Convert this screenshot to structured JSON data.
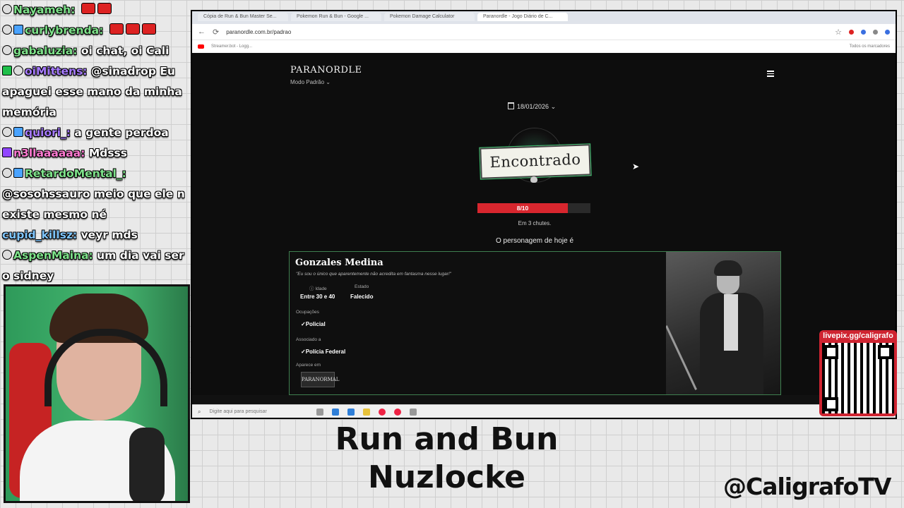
{
  "chat": [
    {
      "user": "Nayameh:",
      "text": "",
      "color": "green",
      "emotes": 2
    },
    {
      "user": "curlybrenda:",
      "text": "",
      "color": "green",
      "emotes": 3
    },
    {
      "user": "gabaluzia:",
      "text": "oi chat, oi Cali",
      "color": "green",
      "emotes": 0
    },
    {
      "user": "oiMittens:",
      "text": "@sinadrop Eu apaguei esse mano da minha memória",
      "color": "purple",
      "emotes": 0
    },
    {
      "user": "quiori_:",
      "text": "a gente perdoa",
      "color": "purple",
      "emotes": 0
    },
    {
      "user": "n3llaaaaaa:",
      "text": "Mdsss",
      "color": "pink",
      "emotes": 0
    },
    {
      "user": "RetardoMental_:",
      "text": "@sosohssauro meio que ele n existe mesmo né",
      "color": "green",
      "emotes": 0
    },
    {
      "user": "cupid_killsz:",
      "text": "veyr mds",
      "color": "green",
      "emotes": 0
    },
    {
      "user": "AspenMaina:",
      "text": "um dia vai ser o sidney",
      "color": "green",
      "emotes": 0
    }
  ],
  "browser": {
    "tabs": [
      "Cópia de Run & Bun Master Se...",
      "Pokemon Run & Bun - Google ...",
      "Pokemon Damage Calculator",
      "Paranordle - Jogo Diário de C..."
    ],
    "active_tab": 3,
    "url": "paranordle.com.br/padrao",
    "bookmark": "Streamer.bot - Logg...",
    "bookmarks_folder": "Todos os marcadores"
  },
  "site": {
    "logo": "PARANORDLE",
    "mode": "Modo Padrão",
    "date": "18/01/2026",
    "stamp": "Encontrado",
    "score_label": "8/10",
    "score_fraction": 0.8,
    "guesses": "Em 3 chutes.",
    "today_label": "O personagem de hoje é",
    "character": {
      "name": "Gonzales Medina",
      "quote": "\"Eu sou o único que aparentemente não acredita em fantasma nesse lugar!\"",
      "age_label": "Idade",
      "age_value": "Entre 30 e 40",
      "state_label": "Estado",
      "state_value": "Falecido",
      "occupations_label": "Ocupações",
      "occupation": "Policial",
      "associated_label": "Associado a",
      "associated": "Polícia Federal",
      "appears_label": "Aparece em",
      "appears_logo": "PARANORMAL"
    }
  },
  "taskbar": {
    "search_placeholder": "Digite aqui para pesquisar"
  },
  "overlay": {
    "title_line1": "Run and Bun",
    "title_line2": "Nuzlocke",
    "handle": "@CaligrafoTV",
    "qr_label": "livepix.gg/caligrafo"
  }
}
